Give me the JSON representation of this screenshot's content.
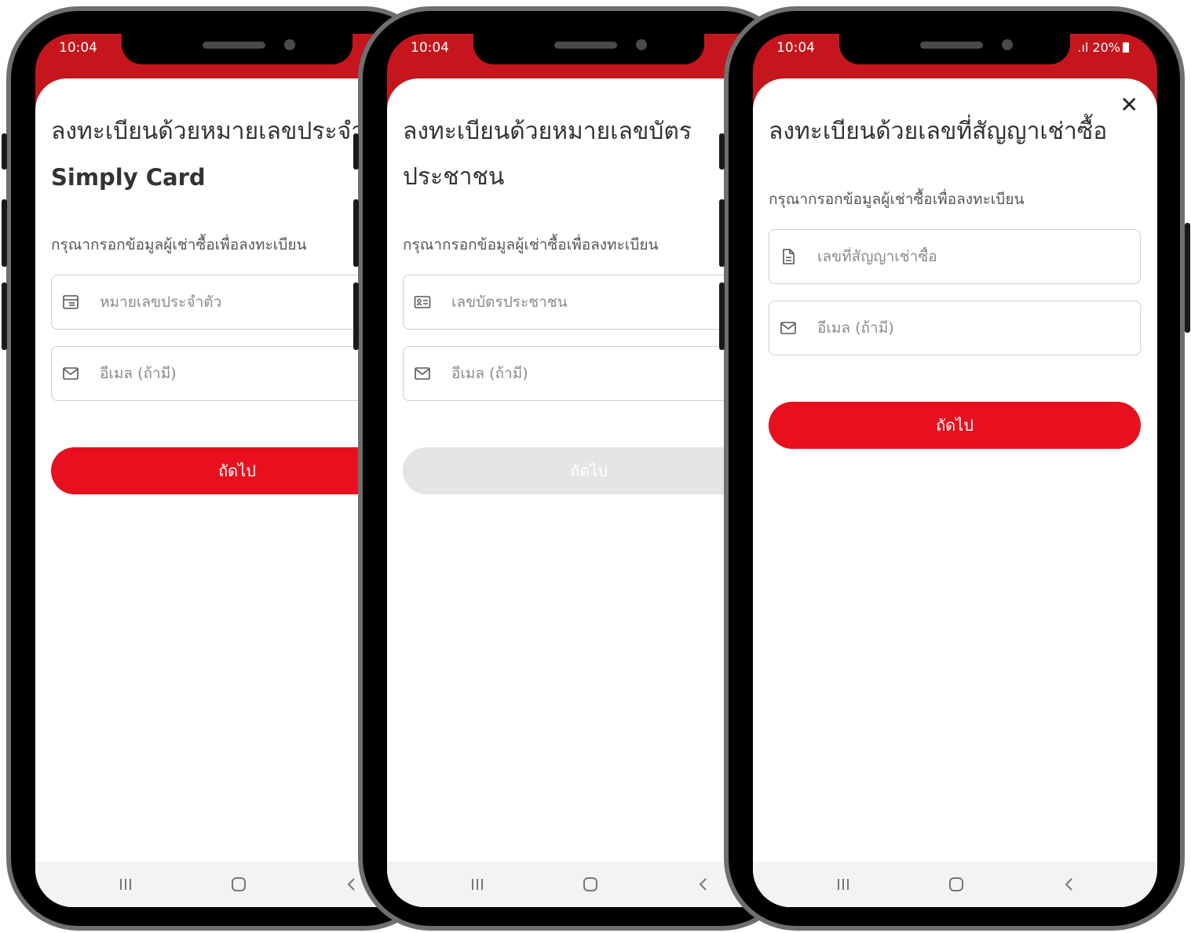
{
  "icons": {
    "id_card": "id-card-icon",
    "contact_card": "contact-card-icon",
    "document": "document-icon",
    "mail": "mail-icon",
    "close": "close-icon",
    "nav_recent": "recent-apps-icon",
    "nav_home": "home-icon",
    "nav_back": "back-icon"
  },
  "colors": {
    "brand_red": "#c4161c",
    "button_red": "#e8101e",
    "button_disabled": "#e4e4e4"
  },
  "phones": [
    {
      "status": {
        "time": "10:04"
      },
      "title": {
        "line1": "ลงทะเบียนด้วยหมายเลขประจำ",
        "line2": "Simply Card"
      },
      "subtitle": "กรุณากรอกข้อมูลผู้เช่าซื้อเพื่อลงทะเบียน",
      "fields": [
        {
          "placeholder": "หมายเลขประจำตัว",
          "value": ""
        },
        {
          "placeholder": "อีเมล (ถ้ามี)",
          "value": ""
        }
      ],
      "button": {
        "label": "ถัดไป",
        "state": "enabled"
      }
    },
    {
      "status": {
        "time": "10:04"
      },
      "title": {
        "line1": "ลงทะเบียนด้วยหมายเลขบัตร",
        "line2": "ประชาชน"
      },
      "subtitle": "กรุณากรอกข้อมูลผู้เช่าซื้อเพื่อลงทะเบียน",
      "fields": [
        {
          "placeholder": "เลขบัตรประชาชน",
          "value": ""
        },
        {
          "placeholder": "อีเมล (ถ้ามี)",
          "value": ""
        }
      ],
      "button": {
        "label": "ถัดไป",
        "state": "disabled"
      }
    },
    {
      "status": {
        "time": "10:04",
        "battery": "20%"
      },
      "title": {
        "line1": "ลงทะเบียนด้วยเลขที่สัญญาเช่าซื้อ"
      },
      "subtitle": "กรุณากรอกข้อมูลผู้เช่าซื้อเพื่อลงทะเบียน",
      "fields": [
        {
          "placeholder": "เลขที่สัญญาเช่าซื้อ",
          "value": ""
        },
        {
          "placeholder": "อีเมล (ถ้ามี)",
          "value": ""
        }
      ],
      "button": {
        "label": "ถัดไป",
        "state": "enabled"
      }
    }
  ]
}
